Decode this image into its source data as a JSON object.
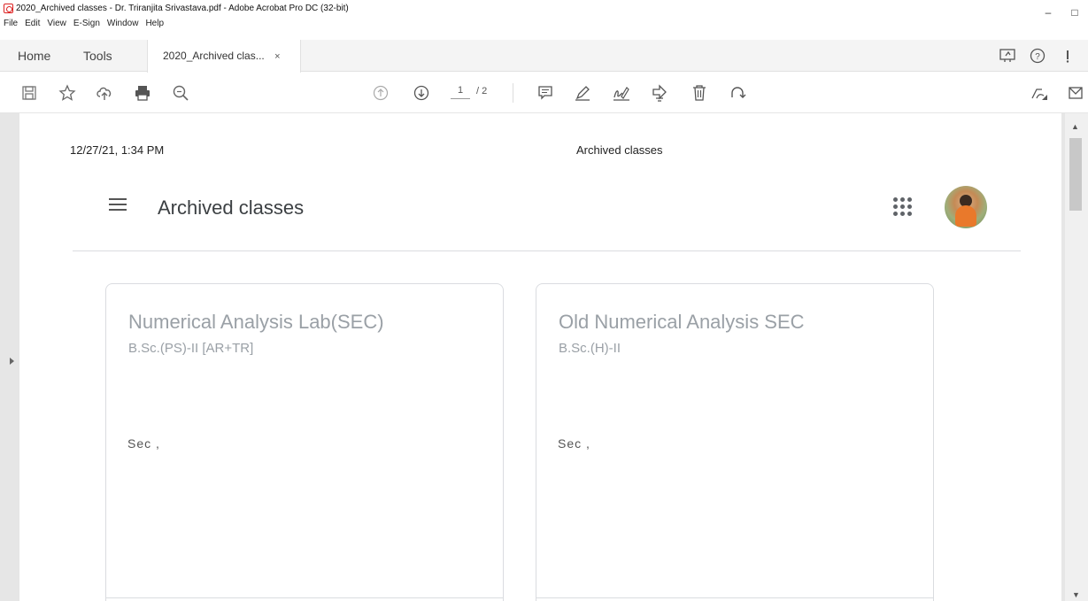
{
  "window": {
    "title": "2020_Archived classes - Dr. Triranjita Srivastava.pdf - Adobe Acrobat Pro DC (32-bit)",
    "minimize": "–",
    "maximize": "□"
  },
  "menubar": {
    "items": [
      "File",
      "Edit",
      "View",
      "E-Sign",
      "Window",
      "Help"
    ]
  },
  "tabs": {
    "home": "Home",
    "tools": "Tools",
    "document": "2020_Archived clas...",
    "close": "×"
  },
  "toolbar": {
    "current_page": "1",
    "total_pages": "/ 2"
  },
  "pdf": {
    "header_left": "12/27/21, 1:34 PM",
    "header_center": "Archived classes"
  },
  "classroom": {
    "title": "Archived classes",
    "cards": [
      {
        "title": "Numerical Analysis Lab(SEC)",
        "subtitle": "B.Sc.(PS)-II [AR+TR]",
        "extra": "Sec ,"
      },
      {
        "title": "Old Numerical Analysis SEC",
        "subtitle": "B.Sc.(H)-II",
        "extra": "Sec ,"
      }
    ]
  },
  "icons": {
    "save": "save-icon",
    "bookmark": "star-icon",
    "upload": "cloud-upload-icon",
    "print": "print-icon",
    "zoom": "zoom-icon",
    "prev_page": "arrow-up-circle-icon",
    "next_page": "arrow-down-circle-icon",
    "comment": "comment-icon",
    "highlight": "pen-icon",
    "sign": "sign-icon",
    "stamp": "stamp-icon",
    "delete": "trash-icon",
    "rotate": "rotate-icon",
    "share": "share-icon",
    "help": "help-icon",
    "apps": "apps-grid-icon"
  },
  "colors": {
    "acrobat_red": "#d22222",
    "card_text": "#9aa0a6",
    "divider": "#dadce0"
  }
}
